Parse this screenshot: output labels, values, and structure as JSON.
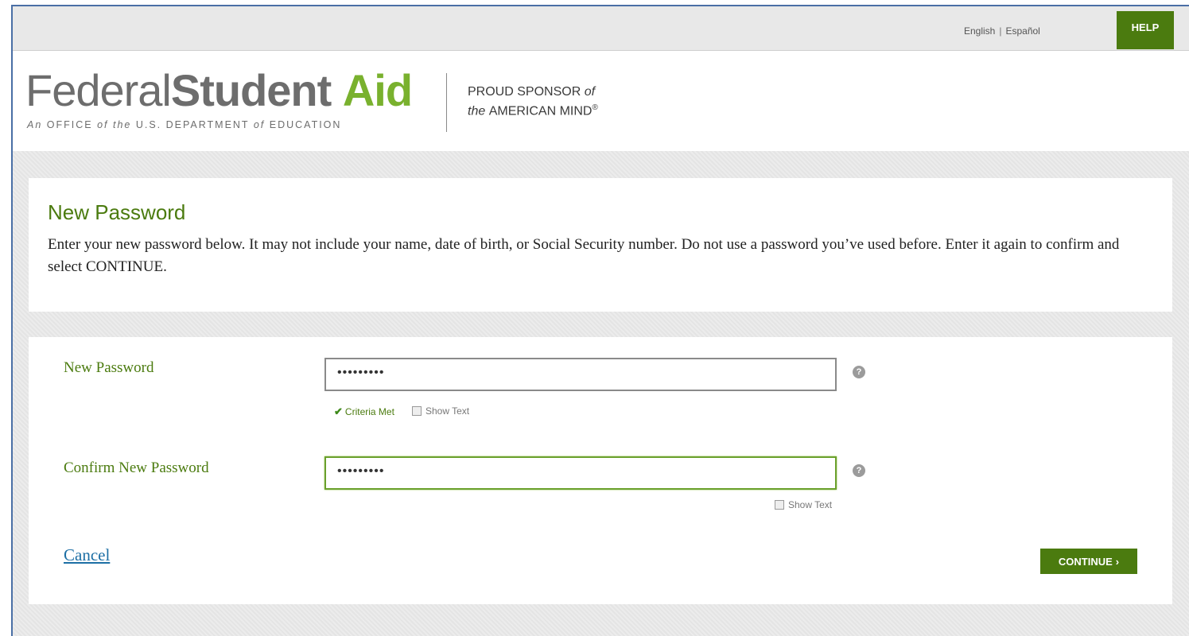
{
  "topbar": {
    "lang_english": "English",
    "lang_separator": "|",
    "lang_espanol": "Español",
    "help_label": "HELP"
  },
  "header": {
    "logo_word1": "Federal",
    "logo_word2": "Student",
    "logo_word3": "Aid",
    "logo_sub_1": "An ",
    "logo_sub_2": "OFFICE ",
    "logo_sub_3": "of the ",
    "logo_sub_4": "U.S. DEPARTMENT ",
    "logo_sub_5": "of ",
    "logo_sub_6": "EDUCATION",
    "sponsor_line1_a": "PROUD SPONSOR ",
    "sponsor_line1_b": "of",
    "sponsor_line2_a": "the ",
    "sponsor_line2_b": "AMERICAN MIND",
    "sponsor_mark": "®"
  },
  "intro": {
    "title": "New Password",
    "text": "Enter your new password below. It may not include your name, date of birth, or Social Security number. Do not use a password you’ve used before. Enter it again to confirm and select CONTINUE."
  },
  "form": {
    "new_password_label": "New Password",
    "new_password_value": "•••••••••",
    "criteria_text": "Criteria Met",
    "show_text_label": "Show Text",
    "confirm_password_label": "Confirm New Password",
    "confirm_password_value": "•••••••••",
    "confirm_show_text_label": "Show Text",
    "help_glyph": "?",
    "cancel_label": "Cancel",
    "continue_label": "CONTINUE",
    "continue_chevron": "›"
  },
  "colors": {
    "brand_green": "#4b7b0f",
    "logo_green": "#79b12e",
    "link_blue": "#1d6fa5"
  }
}
